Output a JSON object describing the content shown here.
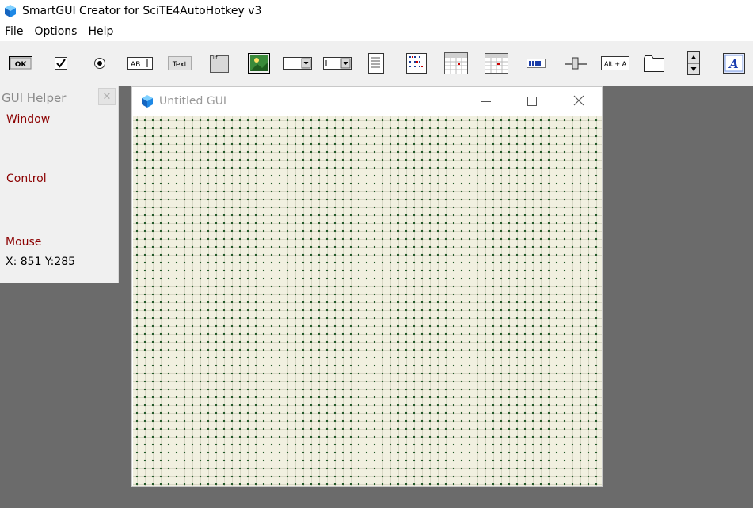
{
  "app": {
    "title": "SmartGUI Creator for SciTE4AutoHotkey v3",
    "icon": "cube-icon",
    "icon_color": "#1e88e5"
  },
  "menu": [
    "File",
    "Options",
    "Help"
  ],
  "toolbar": {
    "tools": [
      {
        "name": "button-tool",
        "text": "OK"
      },
      {
        "name": "checkbox-tool"
      },
      {
        "name": "radio-tool"
      },
      {
        "name": "edit-tool",
        "text": "AB"
      },
      {
        "name": "text-tool",
        "text": "Text"
      },
      {
        "name": "groupbox-tool"
      },
      {
        "name": "picture-tool"
      },
      {
        "name": "dropdown-tool"
      },
      {
        "name": "combobox-tool"
      },
      {
        "name": "listbox-tool"
      },
      {
        "name": "listview-tool"
      },
      {
        "name": "datetime-tool"
      },
      {
        "name": "monthcal-tool"
      },
      {
        "name": "progress-tool"
      },
      {
        "name": "slider-tool"
      },
      {
        "name": "hotkey-tool",
        "text": "Alt + A"
      },
      {
        "name": "tab-tool"
      },
      {
        "name": "updown-tool"
      },
      {
        "name": "font-tool",
        "text": "A"
      }
    ]
  },
  "gui_helper": {
    "title": "GUI Helper",
    "close_glyph": "✕",
    "window_label": "Window",
    "control_label": "Control",
    "mouse_label": "Mouse",
    "coords": "X: 851  Y:285"
  },
  "child_window": {
    "title": "Untitled GUI",
    "grid_color": "#f1f0e0",
    "dot_color": "#245a2a"
  },
  "colors": {
    "workspace": "#6b6b6b",
    "label_red": "#8b0000",
    "toolbar_bg": "#f0f0f0"
  }
}
